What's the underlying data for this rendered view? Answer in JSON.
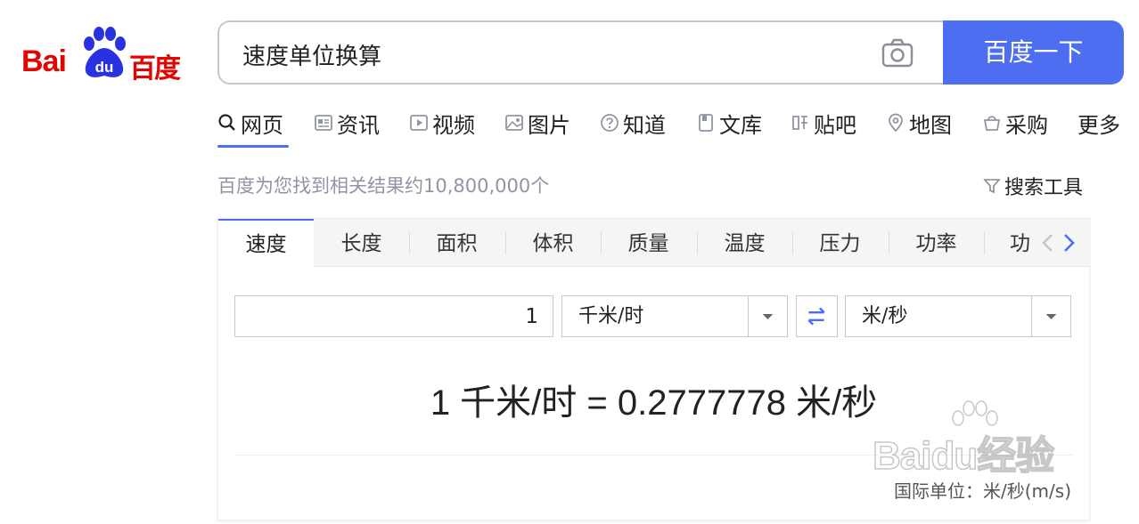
{
  "logo": {
    "bai": "Bai",
    "du": "du",
    "cn": "百度"
  },
  "search": {
    "query": "速度单位换算",
    "button_label": "百度一下"
  },
  "nav": {
    "items": [
      {
        "label": "网页",
        "icon": "search-icon"
      },
      {
        "label": "资讯",
        "icon": "news-icon"
      },
      {
        "label": "视频",
        "icon": "video-icon"
      },
      {
        "label": "图片",
        "icon": "image-icon"
      },
      {
        "label": "知道",
        "icon": "question-icon"
      },
      {
        "label": "文库",
        "icon": "doc-icon"
      },
      {
        "label": "贴吧",
        "icon": "tieba-icon"
      },
      {
        "label": "地图",
        "icon": "map-icon"
      },
      {
        "label": "采购",
        "icon": "shop-icon"
      },
      {
        "label": "更多",
        "icon": ""
      }
    ]
  },
  "results": {
    "count_text": "百度为您找到相关结果约10,800,000个",
    "tools_label": "搜索工具"
  },
  "converter": {
    "tabs": [
      "速度",
      "长度",
      "面积",
      "体积",
      "质量",
      "温度",
      "压力",
      "功率",
      "功"
    ],
    "active_tab": "速度",
    "input_value": "1",
    "from_unit": "千米/时",
    "to_unit": "米/秒",
    "result": "1 千米/时 = 0.2777778 米/秒",
    "si_unit": "国际单位：米/秒(m/s)"
  },
  "watermark": {
    "text": "Baidu经验"
  },
  "colors": {
    "brand_blue": "#4e6ef2",
    "logo_red": "#e10602",
    "logo_blue": "#2932e1"
  }
}
